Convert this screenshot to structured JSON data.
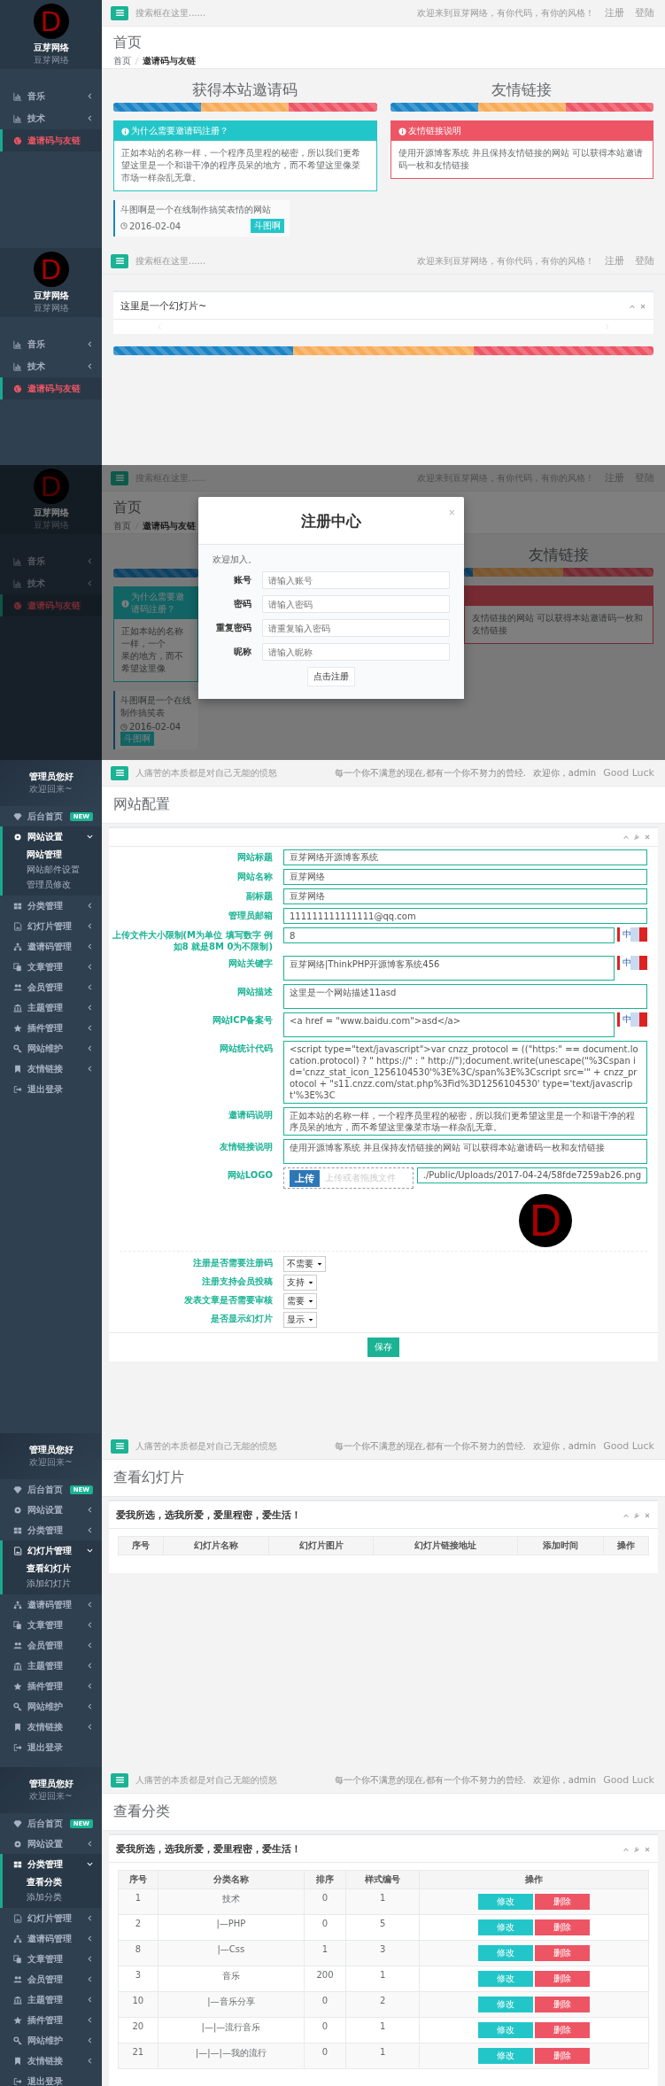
{
  "frontend_screens": [
    {
      "kind": "home",
      "logo": {
        "letter": "D",
        "name": "豆芽网络",
        "subtitle": "豆芽网络"
      },
      "nav": [
        {
          "label": "音乐",
          "selected": false,
          "expanded": false
        },
        {
          "label": "技术",
          "selected": false,
          "expanded": false
        },
        {
          "label": "邀请码与友链",
          "selected": true
        }
      ],
      "topbar": {
        "search_placeholder": "搜索框在这里......",
        "welcome": "欢迎来到豆芽网络，有你代码，有你的风格！",
        "links": [
          "注册",
          "登陆"
        ]
      },
      "header": {
        "title": "首页",
        "breadcrumb": [
          "首页",
          "邀请码与友链"
        ]
      },
      "columns": [
        {
          "title": "获得本站邀请码",
          "box_title": "为什么需要邀请码注册？",
          "box_text": "正如本站的名称一样，一个程序员里程的秘密，所以我们更希望这里是一个和谐干净的程序员呆的地方，而不希望这里像菜市场一样杂乱无章。",
          "color": "#23c6c8"
        },
        {
          "title": "友情链接",
          "box_title": "友情链接说明",
          "box_text": "使用开源博客系统 并且保持友情链接的网站 可以获得本站邀请码一枚和友情链接",
          "color": "#ed5565"
        }
      ],
      "link_card": {
        "text": "斗图啊是一个在线制作搞笑表情的网站",
        "date": "2016-02-04",
        "tag": "斗图啊"
      }
    },
    {
      "kind": "slider",
      "logo": {
        "letter": "D",
        "name": "豆芽网络",
        "subtitle": "豆芽网络"
      },
      "nav": [
        {
          "label": "音乐",
          "selected": false,
          "expanded": false
        },
        {
          "label": "技术",
          "selected": false,
          "expanded": false
        },
        {
          "label": "邀请码与友链",
          "selected": true
        }
      ],
      "topbar": {
        "search_placeholder": "搜索框在这里......",
        "welcome": "欢迎来到豆芽网络，有你代码，有你的风格！",
        "links": [
          "注册",
          "登陆"
        ]
      },
      "slider": {
        "title": "这里是一个幻灯片~"
      }
    },
    {
      "kind": "modal",
      "logo": {
        "letter": "D",
        "name": "豆芽网络",
        "subtitle": "豆芽网络"
      },
      "nav": [
        {
          "label": "音乐",
          "selected": false,
          "expanded": false
        },
        {
          "label": "技术",
          "selected": false,
          "expanded": false
        },
        {
          "label": "邀请码与友链",
          "selected": true
        }
      ],
      "topbar": {
        "search_placeholder": "搜索框在这里......",
        "welcome": "欢迎来到豆芽网络，有你代码，有你的风格！",
        "links": [
          "注册",
          "登陆"
        ]
      },
      "header": {
        "title": "首页",
        "breadcrumb": [
          "首页",
          "邀请码与友链"
        ]
      },
      "background": {
        "left_box_title": "为什么需要邀请码注册？",
        "left_lines": [
          "正如本站的名称一样，一个",
          "果的地方，而不希望这里像"
        ],
        "card_text": "斗图啊是一个在线制作搞笑表",
        "card_date": "2016-02-04",
        "card_tag": "斗图啊",
        "right_title": "友情链接",
        "right_text": "友情链接的网站 可以获得本站邀请码一枚和友情链接"
      },
      "modal": {
        "title": "注册中心",
        "close": "×",
        "intro": "欢迎加入。",
        "fields": [
          {
            "label": "账号",
            "placeholder": "请输入账号"
          },
          {
            "label": "密码",
            "placeholder": "请输入密码"
          },
          {
            "label": "重复密码",
            "placeholder": "请重复输入密码"
          },
          {
            "label": "昵称",
            "placeholder": "请输入昵称"
          }
        ],
        "button": "点击注册"
      }
    }
  ],
  "admin_screens": [
    {
      "kind": "config",
      "profile": {
        "name": "管理员您好",
        "greeting": "欢迎回来~"
      },
      "menu": [
        {
          "label": "后台首页",
          "kind": "link",
          "badge": "NEW"
        },
        {
          "label": "网站设置",
          "kind": "group",
          "expanded": true,
          "children": [
            {
              "label": "网站管理",
              "selected": true
            },
            {
              "label": "网站邮件设置",
              "selected": false
            },
            {
              "label": "管理员修改",
              "selected": false
            }
          ]
        },
        {
          "label": "分类管理",
          "kind": "group",
          "expanded": false
        },
        {
          "label": "幻灯片管理",
          "kind": "group",
          "expanded": false
        },
        {
          "label": "邀请码管理",
          "kind": "group",
          "expanded": false
        },
        {
          "label": "文章管理",
          "kind": "group",
          "expanded": false
        },
        {
          "label": "会员管理",
          "kind": "group",
          "expanded": false
        },
        {
          "label": "主题管理",
          "kind": "group",
          "expanded": false
        },
        {
          "label": "插件管理",
          "kind": "group",
          "expanded": false
        },
        {
          "label": "网站维护",
          "kind": "group",
          "expanded": false
        },
        {
          "label": "友情链接",
          "kind": "group",
          "expanded": false
        },
        {
          "label": "退出登录",
          "kind": "link"
        }
      ],
      "topbar": {
        "quote": "人痛苦的本质都是对自己无能的愤怒",
        "motto": "每一个你不满意的现在,都有一个你不努力的曾经.",
        "welcome": "欢迎你，admin",
        "luck": "Good Luck"
      },
      "page_title": "网站配置",
      "form": {
        "fields": [
          {
            "kind": "input",
            "label": "网站标题",
            "value": "豆芽网络开源博客系统"
          },
          {
            "kind": "input",
            "label": "网站名称",
            "value": "豆芽网络"
          },
          {
            "kind": "input",
            "label": "副标题",
            "value": "豆芽网络"
          },
          {
            "kind": "input",
            "label": "管理员邮箱",
            "value": "111111111111111@qq.com"
          },
          {
            "kind": "input",
            "label": "上传文件大小限制(M为单位 填写数字 例如8 就是8M 0为不限制)",
            "value": "8",
            "ime": "中"
          },
          {
            "kind": "textarea",
            "label": "网站关键字",
            "value": "豆芽网络|ThinkPHP开源博客系统456",
            "ime": "中"
          },
          {
            "kind": "textarea",
            "label": "网站描述",
            "value": "这里是一个网站描述11asd"
          },
          {
            "kind": "textarea",
            "label": "网站ICP备案号",
            "value": "<a href = \"www.baidu.com\">asd</a>",
            "ime": "中"
          },
          {
            "kind": "textarea",
            "label": "网站统计代码",
            "value": "<script type=\"text/javascript\">var cnzz_protocol = ((\"https:\" == document.location.protocol) ? \" https://\" : \" http://\");document.write(unescape(\"%3Cspan id='cnzz_stat_icon_1256104530'%3E%3C/span%3E%3Cscript src='\" + cnzz_protocol + \"s11.cnzz.com/stat.php%3Fid%3D1256104530' type='text/javascript'%3E%3C"
          },
          {
            "kind": "textarea",
            "label": "邀请码说明",
            "value": "正如本站的名称一样，一个程序员里程的秘密，所以我们更希望这里是一个和谐干净的程序员呆的地方，而不希望这里像菜市场一样杂乱无章。"
          },
          {
            "kind": "textarea",
            "label": "友情链接说明",
            "value": "使用开源博客系统 并且保持友情链接的网站 可以获得本站邀请码一枚和友情链接"
          }
        ],
        "logo": {
          "label": "网站LOGO",
          "button": "上传",
          "hint": "上传或者拖拽文件",
          "path": "./Public/Uploads/2017-04-24/58fde7259ab26.png",
          "preview_letter": "D"
        },
        "selects": [
          {
            "label": "注册是否需要注册码",
            "value": "不需要"
          },
          {
            "label": "注册支持会员投稿",
            "value": "支持"
          },
          {
            "label": "发表文章是否需要审核",
            "value": "需要"
          },
          {
            "label": "是否显示幻灯片",
            "value": "显示"
          }
        ],
        "save": "保存"
      }
    },
    {
      "kind": "slides",
      "profile": {
        "name": "管理员您好",
        "greeting": "欢迎回来~"
      },
      "menu": [
        {
          "label": "后台首页",
          "kind": "link",
          "badge": "NEW"
        },
        {
          "label": "网站设置",
          "kind": "group",
          "expanded": false
        },
        {
          "label": "分类管理",
          "kind": "group",
          "expanded": false
        },
        {
          "label": "幻灯片管理",
          "kind": "group",
          "expanded": true,
          "children": [
            {
              "label": "查看幻灯片",
              "selected": true
            },
            {
              "label": "添加幻灯片",
              "selected": false
            }
          ]
        },
        {
          "label": "邀请码管理",
          "kind": "group",
          "expanded": false
        },
        {
          "label": "文章管理",
          "kind": "group",
          "expanded": false
        },
        {
          "label": "会员管理",
          "kind": "group",
          "expanded": false
        },
        {
          "label": "主题管理",
          "kind": "group",
          "expanded": false
        },
        {
          "label": "插件管理",
          "kind": "group",
          "expanded": false
        },
        {
          "label": "网站维护",
          "kind": "group",
          "expanded": false
        },
        {
          "label": "友情链接",
          "kind": "group",
          "expanded": false
        },
        {
          "label": "退出登录",
          "kind": "link"
        }
      ],
      "topbar": {
        "quote": "人痛苦的本质都是对自己无能的愤怒",
        "motto": "每一个你不满意的现在,都有一个你不努力的曾经.",
        "welcome": "欢迎你，admin",
        "luck": "Good Luck"
      },
      "page_title": "查看幻灯片",
      "card_title": "爱我所选，选我所爱，爱里程密，爱生活！",
      "table": {
        "columns": [
          "序号",
          "幻灯片名称",
          "幻灯片图片",
          "幻灯片链接地址",
          "添加时间",
          "操作"
        ]
      }
    },
    {
      "kind": "categories",
      "profile": {
        "name": "管理员您好",
        "greeting": "欢迎回来~"
      },
      "menu": [
        {
          "label": "后台首页",
          "kind": "link",
          "badge": "NEW"
        },
        {
          "label": "网站设置",
          "kind": "group",
          "expanded": false
        },
        {
          "label": "分类管理",
          "kind": "group",
          "expanded": true,
          "children": [
            {
              "label": "查看分类",
              "selected": true
            },
            {
              "label": "添加分类",
              "selected": false
            }
          ]
        },
        {
          "label": "幻灯片管理",
          "kind": "group",
          "expanded": false
        },
        {
          "label": "邀请码管理",
          "kind": "group",
          "expanded": false
        },
        {
          "label": "文章管理",
          "kind": "group",
          "expanded": false
        },
        {
          "label": "会员管理",
          "kind": "group",
          "expanded": false
        },
        {
          "label": "主题管理",
          "kind": "group",
          "expanded": false
        },
        {
          "label": "插件管理",
          "kind": "group",
          "expanded": false
        },
        {
          "label": "网站维护",
          "kind": "group",
          "expanded": false
        },
        {
          "label": "友情链接",
          "kind": "group",
          "expanded": false
        },
        {
          "label": "退出登录",
          "kind": "link"
        }
      ],
      "topbar": {
        "quote": "人痛苦的本质都是对自己无能的愤怒",
        "motto": "每一个你不满意的现在,都有一个你不努力的曾经.",
        "welcome": "欢迎你，admin",
        "luck": "Good Luck"
      },
      "page_title": "查看分类",
      "card_title": "爱我所选，选我所爱，爱里程密，爱生活！",
      "table": {
        "columns": [
          "序号",
          "分类名称",
          "排序",
          "样式编号",
          "操作"
        ],
        "rows": [
          {
            "cells": [
              "1",
              "技术",
              "0",
              "1"
            ],
            "actions": [
              "修改",
              "删除"
            ]
          },
          {
            "cells": [
              "2",
              "|—PHP",
              "0",
              "5"
            ],
            "actions": [
              "修改",
              "删除"
            ]
          },
          {
            "cells": [
              "8",
              "|—Css",
              "1",
              "3"
            ],
            "actions": [
              "修改",
              "删除"
            ]
          },
          {
            "cells": [
              "3",
              "音乐",
              "200",
              "1"
            ],
            "actions": [
              "修改",
              "删除"
            ]
          },
          {
            "cells": [
              "10",
              "|—音乐分享",
              "0",
              "2"
            ],
            "actions": [
              "修改",
              "删除"
            ]
          },
          {
            "cells": [
              "20",
              "|—|—流行音乐",
              "0",
              "1"
            ],
            "actions": [
              "修改",
              "删除"
            ]
          },
          {
            "cells": [
              "21",
              "|—|—|—我的流行",
              "0",
              "1"
            ],
            "actions": [
              "修改",
              "删除"
            ]
          }
        ]
      }
    }
  ]
}
